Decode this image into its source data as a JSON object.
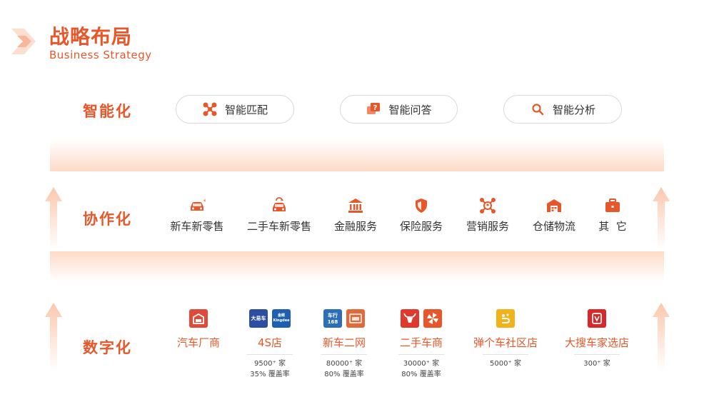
{
  "header": {
    "title": "战略布局",
    "subtitle": "Business Strategy"
  },
  "colors": {
    "accent": "#e8572a",
    "band": "#fdd3bd",
    "pill_border": "#d9d9d9"
  },
  "rows": {
    "intelligent": {
      "label": "智能化",
      "pills": [
        {
          "label": "智能匹配",
          "icon": "network-nodes-icon"
        },
        {
          "label": "智能问答",
          "icon": "question-chat-icon"
        },
        {
          "label": "智能分析",
          "icon": "search-icon"
        }
      ]
    },
    "collaborative": {
      "label": "协作化",
      "items": [
        {
          "label": "新车新零售",
          "icon": "new-car-icon"
        },
        {
          "label": "二手车新零售",
          "icon": "used-car-icon"
        },
        {
          "label": "金融服务",
          "icon": "bank-icon"
        },
        {
          "label": "保险服务",
          "icon": "shield-icon"
        },
        {
          "label": "营销服务",
          "icon": "marketing-network-icon"
        },
        {
          "label": "仓储物流",
          "icon": "warehouse-icon"
        },
        {
          "label": "其  它",
          "icon": "briefcase-icon"
        }
      ]
    },
    "digital": {
      "label": "数字化",
      "items": [
        {
          "label": "汽车厂商",
          "icons": [
            "factory-logo-icon"
          ],
          "stats": []
        },
        {
          "label": "4S店",
          "icons": [
            "dayiche-logo-icon",
            "kingdee-logo-icon"
          ],
          "logo_texts": [
            "大易车",
            "金蝶 Kingdee"
          ],
          "stats": [
            "9500⁺ 家",
            "35% 覆盖率"
          ]
        },
        {
          "label": "新车二网",
          "icons": [
            "chexing168-logo-icon",
            "showroom-logo-icon"
          ],
          "logo_texts": [
            "车行168"
          ],
          "stats": [
            "80000⁺ 家",
            "80% 覆盖率"
          ]
        },
        {
          "label": "二手车商",
          "icons": [
            "bull-logo-icon",
            "pinwheel-logo-icon"
          ],
          "stats": [
            "30000⁺ 家",
            "80% 覆盖率"
          ]
        },
        {
          "label": "弹个车社区店",
          "icons": [
            "tangeche-logo-icon"
          ],
          "stats": [
            "5000⁺ 家"
          ]
        },
        {
          "label": "大搜车家选店",
          "icons": [
            "dasouche-logo-icon"
          ],
          "stats": [
            "300⁺ 家"
          ]
        }
      ]
    }
  }
}
